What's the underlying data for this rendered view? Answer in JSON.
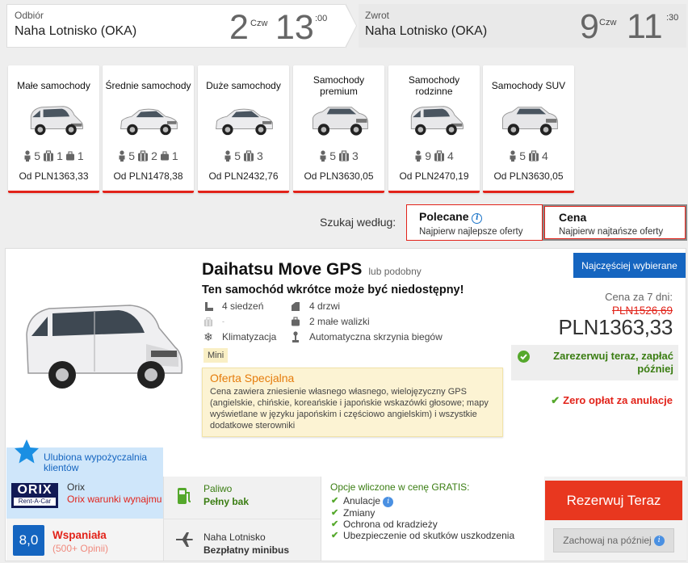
{
  "header": {
    "pickup": {
      "label": "Odbiór",
      "location": "Naha Lotnisko (OKA)",
      "day": "2",
      "weekday": "Czw",
      "hour": "13",
      "minutes": ":00"
    },
    "return": {
      "label": "Zwrot",
      "location": "Naha Lotnisko (OKA)",
      "day": "9",
      "weekday": "Czw",
      "hour": "11",
      "minutes": ":30"
    }
  },
  "categories": [
    {
      "name": "Małe samochody",
      "seats": "5",
      "bags_large": "1",
      "bags_small": "1",
      "price": "Od PLN1363,33"
    },
    {
      "name": "Średnie samochody",
      "seats": "5",
      "bags_large": "2",
      "bags_small": "1",
      "price": "Od PLN1478,38"
    },
    {
      "name": "Duże samochody",
      "seats": "5",
      "bags_large": "3",
      "price": "Od PLN2432,76"
    },
    {
      "name": "Samochody premium",
      "seats": "5",
      "bags_large": "3",
      "price": "Od PLN3630,05"
    },
    {
      "name": "Samochody rodzinne",
      "seats": "9",
      "bags_large": "4",
      "price": "Od PLN2470,19"
    },
    {
      "name": "Samochody SUV",
      "seats": "5",
      "bags_large": "4",
      "price": "Od PLN3630,05"
    }
  ],
  "sort": {
    "label": "Szukaj według:",
    "recommended": {
      "title": "Polecane",
      "subtitle": "Najpierw najlepsze oferty"
    },
    "price": {
      "title": "Cena",
      "subtitle": "Najpierw najtańsze oferty"
    }
  },
  "result": {
    "badge": "Najczęściej wybierane",
    "title": "Daihatsu Move GPS",
    "or_similar": "lub podobny",
    "availability_warning": "Ten samochód wkrótce może być niedostępny!",
    "features": {
      "seats": "4 siedzeń",
      "doors": "4 drzwi",
      "bags_large": "-",
      "bags_small": "2 małe walizki",
      "ac": "Klimatyzacja",
      "transmission": "Automatyczna skrzynia biegów"
    },
    "class_tag": "Mini",
    "offer": {
      "title": "Oferta Specjalna",
      "body": "Cena zawiera zniesienie własnego własnego, wielojęzyczny GPS (angielskie, chińskie, koreańskie i japońskie wskazówki głosowe; mapy wyświetlane w języku japońskim i częściowo angielskim) i wszystkie dodatkowe sterowniki"
    },
    "price_label": "Cena za 7 dni:",
    "price_old": "PLN1526,69",
    "price_new": "PLN1363,33",
    "pay_later": "Zarezerwuj teraz, zapłać później",
    "no_fee": "Zero opłat za anulacje",
    "favorite": "Ulubiona wypożyczalnia klientów",
    "supplier": {
      "logo_main": "ORIX",
      "logo_sub": "Rent-A-Car",
      "name": "Orix",
      "terms": "Orix warunki wynajmu"
    },
    "rating": {
      "score": "8,0",
      "label": "Wspaniała",
      "reviews": "(500+ Opinii)"
    },
    "fuel": {
      "label": "Paliwo",
      "value": "Pełny bak"
    },
    "pickup": {
      "label": "Naha Lotnisko",
      "value": "Bezpłatny minibus"
    },
    "included": {
      "title": "Opcje wliczone w cenę GRATIS:",
      "items": [
        "Anulacje",
        "Zmiany",
        "Ochrona od kradzieży",
        "Ubezpieczenie od skutków uszkodzenia"
      ]
    },
    "book_label": "Rezerwuj Teraz",
    "save_label": "Zachowaj na później"
  },
  "colors": {
    "accent_red": "#e2231a",
    "accent_blue": "#1565c0",
    "green": "#3a7d12"
  },
  "icons": [
    "person-icon",
    "suitcase-icon",
    "small-bag-icon",
    "info-icon",
    "check-icon",
    "star-icon",
    "fuel-pump-icon",
    "plane-icon",
    "door-icon",
    "snowflake-icon",
    "gear-shift-icon"
  ]
}
